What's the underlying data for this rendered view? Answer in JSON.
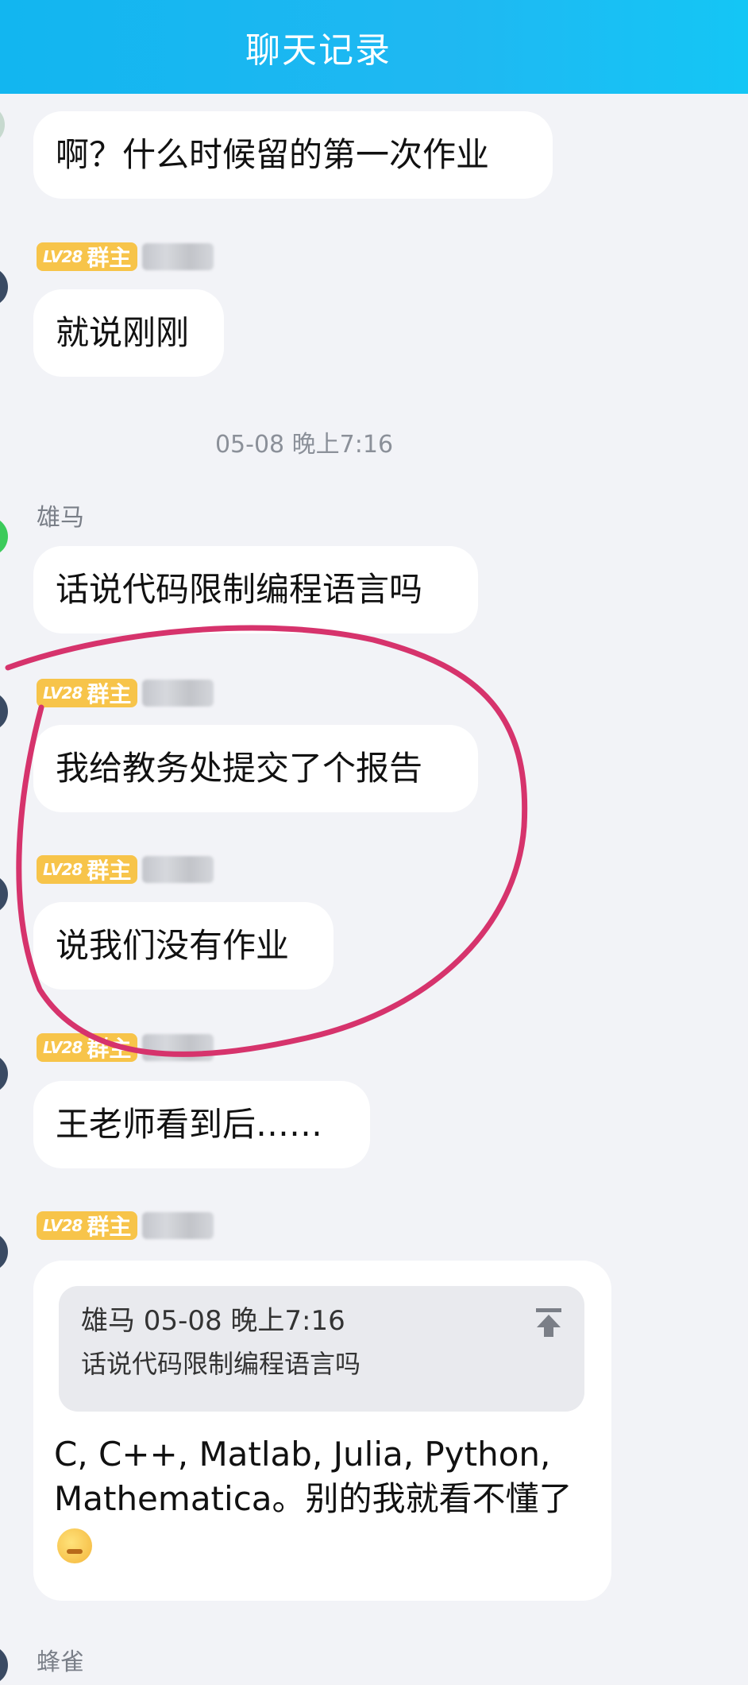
{
  "header": {
    "title": "聊天记录"
  },
  "messages": [
    {
      "text": "啊？什么时候留的第一次作业"
    },
    {
      "badge_level": "LV28",
      "badge_role": "群主",
      "text": "就说刚刚"
    },
    {
      "timestamp": "05-08 晚上7:16"
    },
    {
      "sender": "雄马",
      "text": "话说代码限制编程语言吗"
    },
    {
      "badge_level": "LV28",
      "badge_role": "群主",
      "text": "我给教务处提交了个报告"
    },
    {
      "badge_level": "LV28",
      "badge_role": "群主",
      "text": "说我们没有作业"
    },
    {
      "badge_level": "LV28",
      "badge_role": "群主",
      "text": "王老师看到后……"
    },
    {
      "badge_level": "LV28",
      "badge_role": "群主",
      "quote": {
        "meta": "雄马 05-08 晚上7:16",
        "text": "话说代码限制编程语言吗"
      },
      "text": "C, C++, Matlab, Julia, Python, Mathematica。别的我就看不懂了"
    },
    {
      "sender": "蜂雀"
    }
  ],
  "colors": {
    "header": "#1fb8f2",
    "badge": "#f7c44a",
    "annotation_circle": "#d6336c",
    "background": "#f2f3f7"
  },
  "icons": {
    "quote_jump": "arrow-up-to-top-icon",
    "emoji": "thinking-face-emoji"
  }
}
